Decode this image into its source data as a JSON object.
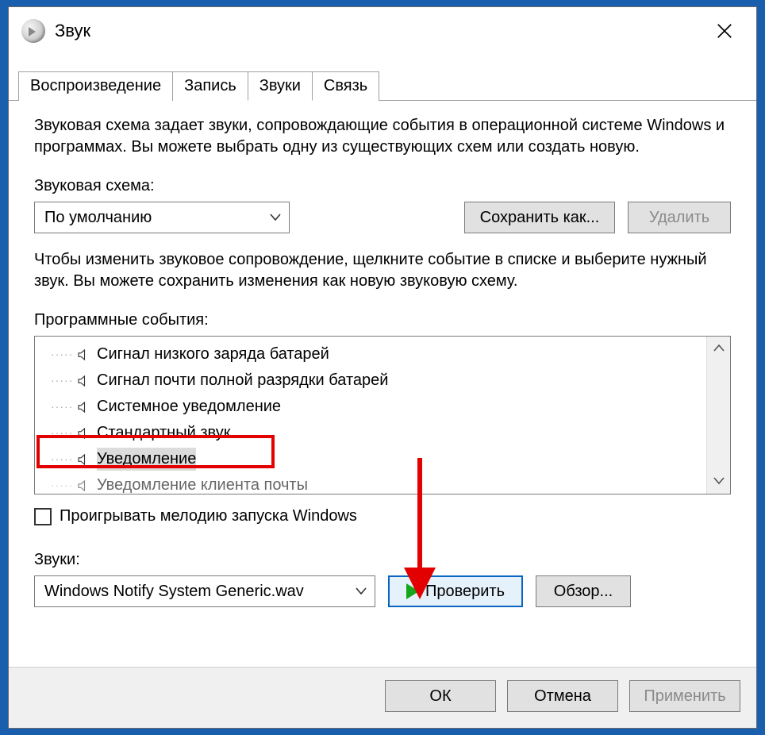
{
  "window": {
    "title": "Звук"
  },
  "tabs": [
    {
      "label": "Воспроизведение",
      "active": false
    },
    {
      "label": "Запись",
      "active": false
    },
    {
      "label": "Звуки",
      "active": true
    },
    {
      "label": "Связь",
      "active": false
    }
  ],
  "panel": {
    "description": "Звуковая схема задает звуки, сопровождающие события в операционной системе Windows и программах. Вы можете выбрать одну из существующих схем или создать новую.",
    "scheme_label": "Звуковая схема:",
    "scheme_value": "По умолчанию",
    "save_as_label": "Сохранить как...",
    "delete_label": "Удалить",
    "events_hint": "Чтобы изменить звуковое сопровождение, щелкните событие в списке и выберите нужный звук. Вы можете сохранить изменения как новую звуковую схему.",
    "events_label": "Программные события:",
    "events": [
      {
        "text": "Сигнал низкого заряда батарей",
        "selected": false
      },
      {
        "text": "Сигнал почти полной разрядки батарей",
        "selected": false
      },
      {
        "text": "Системное уведомление",
        "selected": false
      },
      {
        "text": "Стандартный звук",
        "selected": false
      },
      {
        "text": "Уведомление",
        "selected": true
      },
      {
        "text": "Уведомление клиента почты",
        "selected": false
      }
    ],
    "play_startup_label": "Проигрывать мелодию запуска Windows",
    "sounds_label": "Звуки:",
    "sounds_value": "Windows Notify System Generic.wav",
    "test_label": "Проверить",
    "browse_label": "Обзор..."
  },
  "footer": {
    "ok": "ОК",
    "cancel": "Отмена",
    "apply": "Применить"
  }
}
